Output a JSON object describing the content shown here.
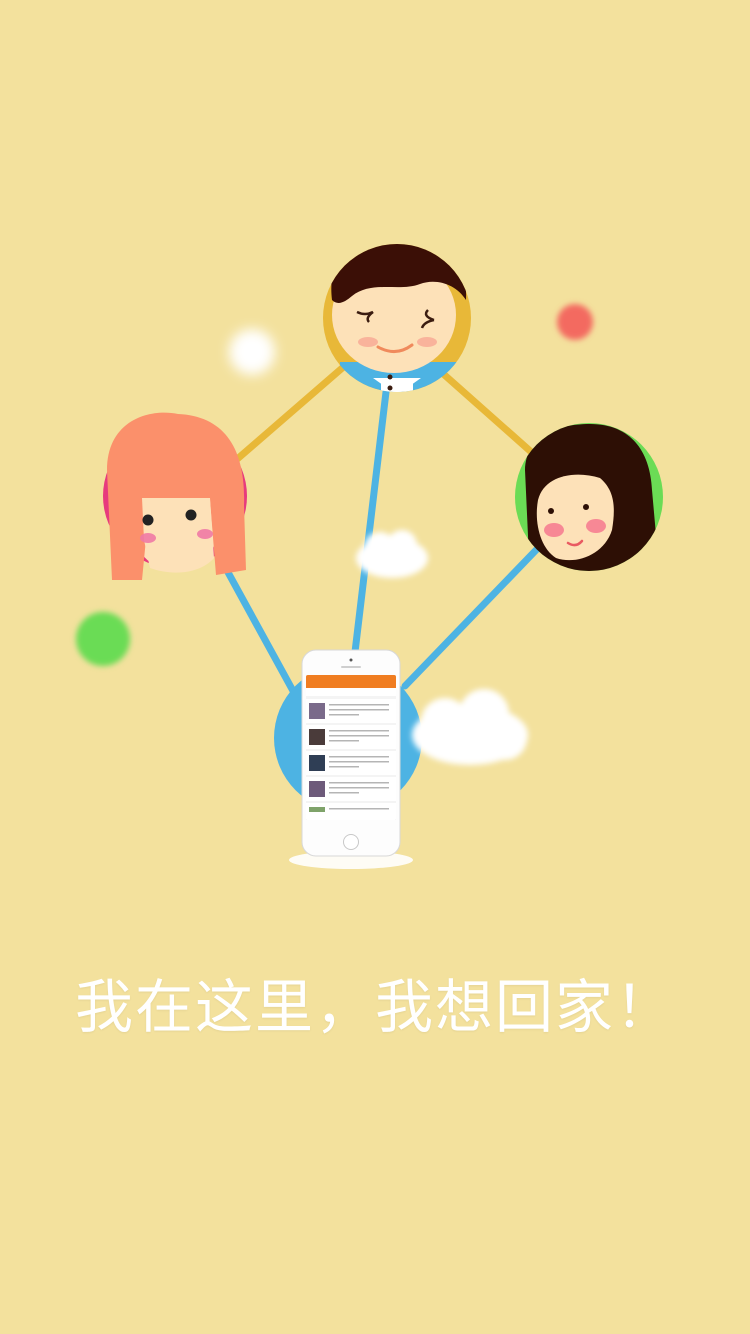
{
  "screen": {
    "background_color": "#f3e19d"
  },
  "tagline": {
    "text": "我在这里，我想回家！"
  },
  "illustration": {
    "nodes": [
      {
        "name": "boy-avatar",
        "ring_color": "#e8b838"
      },
      {
        "name": "girl-pink-avatar",
        "ring_color": "#e73b7d",
        "hair_color": "#fb906b"
      },
      {
        "name": "girl-dark-avatar",
        "ring_color": "#6bdc55",
        "hair_color": "#2d0f05"
      },
      {
        "name": "phone-hub",
        "ring_color": "#4db3e3"
      }
    ],
    "line_colors": {
      "top_links": "#e8b838",
      "to_phone": "#4db3e3"
    },
    "decor_colors": {
      "red_dot": "#f36b61",
      "green_dot": "#6bdc55"
    }
  },
  "phone_mock": {
    "header_color": "#f07d21",
    "row_count": 5
  }
}
